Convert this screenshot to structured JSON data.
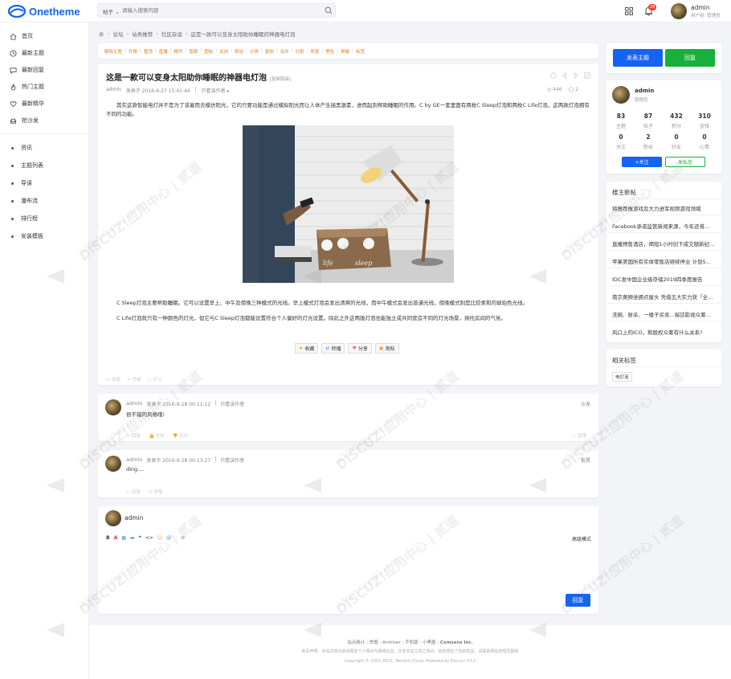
{
  "header": {
    "logo_text": "Onetheme",
    "search_type": "帖子",
    "search_placeholder": "请输入搜索内容",
    "notification_count": "28",
    "user_name": "admin",
    "user_role": "用户组: 管理员"
  },
  "sidebar": {
    "main_items": [
      "首页",
      "最新主题",
      "最新回复",
      "热门主题",
      "最新精华",
      "抢沙发"
    ],
    "sub_items": [
      "资讯",
      "主题列表",
      "导读",
      "瀑布流",
      "排行榜",
      "安装模板"
    ]
  },
  "breadcrumb": [
    "论坛",
    "站务推荐",
    "社区杂谈",
    "这是一款可以变身太阳助你睡眠的神器电灯泡"
  ],
  "admin_tools": [
    "删除主题",
    "升降",
    "置顶",
    "直播",
    "精华",
    "图章",
    "图标",
    "关闭",
    "移动",
    "分类",
    "复制",
    "合并",
    "分割",
    "修复",
    "警告",
    "屏蔽",
    "标签"
  ],
  "post": {
    "title": "这是一款可以变身太阳助你睡眠的神器电灯泡",
    "copy_link": "[复制链接]",
    "author": "admin",
    "posted_at": "发表于  2016-9-27 15:41:44",
    "only_author": "只看该作者",
    "views": "446",
    "replies": "2",
    "para1": "其实这款智能电灯并不是为了该雇而去模仿阳光，它的只要功能是通过模拟阳光而让人体产生褪黑激素，进而起到帮助睡眠的作用。C by GE一套里面有两枚C Sleep灯泡和两枚C Life灯泡，这两款灯泡拥有不同的功能。",
    "para2": "C Sleep灯泡主要帮助睡眠。它可以设置早上、中午及傍晚三种模式的光线。早上模式灯泡会发出清爽的光线，而中午模式会发出普通光线，傍晚模式则是比较柔和的琥珀色光线。",
    "para3": "C Life灯泡就只有一种颜色的灯光，但它与C Sleep灯泡都能设置符合个人偏好的灯光设置。除此之外这两版灯泡也能独立或共同营造不同的灯光场景，烘托房间的气氛。",
    "box_text_1": "life",
    "box_text_2": "sleep",
    "actions": [
      "收藏",
      "转播",
      "分享",
      "淘帖"
    ],
    "footer_links": [
      "回复",
      "举报",
      "评分"
    ]
  },
  "replies": [
    {
      "author": "admin",
      "posted_at": "发表于  2016-9-28 00:11:12",
      "only_author": "只看该作者",
      "floor": "沙发",
      "content": "很不错的风格哦!",
      "actions": [
        "回复",
        "支持",
        "反对"
      ],
      "admin_action": "管理"
    },
    {
      "author": "admin",
      "posted_at": "发表于  2016-9-28 00:13:27",
      "only_author": "只看该作者",
      "floor": "板凳",
      "content": "ding....",
      "actions": [
        "回复",
        "举报"
      ]
    }
  ],
  "reply_box": {
    "user": "admin",
    "advanced_mode": "高级模式",
    "submit": "回复"
  },
  "right": {
    "new_topic_button": "发表主题",
    "reply_button": "回复",
    "profile_name": "admin",
    "profile_role": "管理员",
    "stats": [
      {
        "num": "83",
        "label": "主题"
      },
      {
        "num": "87",
        "label": "帖子"
      },
      {
        "num": "432",
        "label": "积分"
      },
      {
        "num": "310",
        "label": "金钱"
      },
      {
        "num": "0",
        "label": "关注"
      },
      {
        "num": "2",
        "label": "粉丝"
      },
      {
        "num": "0",
        "label": "好友"
      },
      {
        "num": "0",
        "label": "心情"
      }
    ],
    "follow_button": "+关注",
    "message_button": "发私信",
    "new_threads_title": "楼主新帖",
    "new_threads": [
      "将推荐做游戏及大力进军视频游戏领域",
      "Facebook承诺监管新闻来源，今年还将...",
      "直播预售酒店，揭短1小时创下成交额新纪...",
      "苹果美国所有实体零售店继续停业 计划5...",
      "IDC发中国企业级存储2019四季度报告",
      "南京黄狮坐拥点屋头 凭借五大实力获「全...",
      "洗碗、射杀、一楼子买卖...探訪影视众筹...",
      "风口上的ICO，和股权众筹有什么关系?"
    ],
    "tags_title": "相关标签",
    "tags": [
      "电灯泡"
    ]
  },
  "footer": {
    "links": [
      "站点统计",
      "举报",
      "Archiver",
      "手机版",
      "小黑屋",
      "Comsenz Inc."
    ],
    "disclaimer": "免责声明：本站内容均来自网友个人观点与网络信息，并非本站立场之观点，如有侵犯了您的权益，请联系网站管理员删除",
    "copyright": "Copyright © 2001-2021, Tencent Cloud. Powered by Discuz! X3.2"
  },
  "watermark": {
    "brand": "DISCUZ!应用中心 | 贰道",
    "site": "addon.dismall.com"
  },
  "colors": {
    "primary": "#1463f3",
    "green": "#17b03d",
    "orange": "#e67e22",
    "red": "#ff3b30"
  }
}
